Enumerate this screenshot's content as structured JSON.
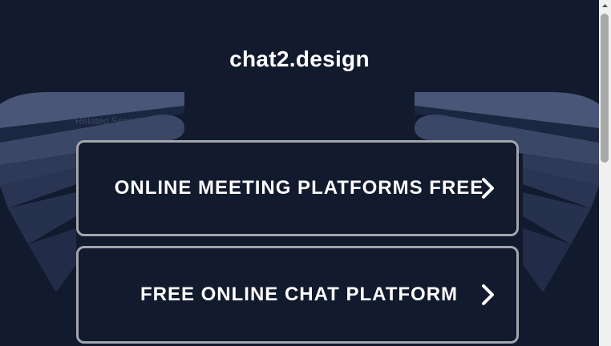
{
  "site": {
    "domain": "chat2.design"
  },
  "related": {
    "label": "Related Searches:"
  },
  "links": [
    {
      "label": "ONLINE MEETING PLATFORMS FREE"
    },
    {
      "label": "FREE ONLINE CHAT PLATFORM"
    }
  ],
  "colors": {
    "background": "#121a2e",
    "box_border": "#a3a6ad",
    "text": "#ffffff"
  },
  "icons": {
    "link_arrow": "chevron-right-icon",
    "scroll_up": "arrow-up-icon"
  }
}
